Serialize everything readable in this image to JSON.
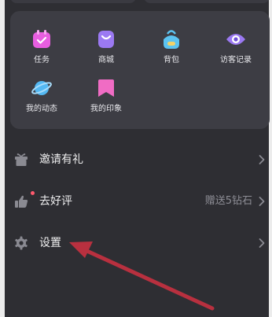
{
  "grid": {
    "items": [
      {
        "label": "任务",
        "icon": "task-calendar-icon",
        "color": "#e85ee0"
      },
      {
        "label": "商城",
        "icon": "shopping-bag-icon",
        "color": "#9b79f2"
      },
      {
        "label": "背包",
        "icon": "backpack-icon",
        "color": "#5cc4f2"
      },
      {
        "label": "访客记录",
        "icon": "eye-icon",
        "color": "#9b79f2"
      },
      {
        "label": "我的动态",
        "icon": "planet-icon",
        "color": "#54b8f2"
      },
      {
        "label": "我的印象",
        "icon": "bookmark-icon",
        "color": "#f06cc4"
      }
    ]
  },
  "menu": {
    "invite": {
      "label": "邀请有礼",
      "icon": "gift-icon"
    },
    "review": {
      "label": "去好评",
      "icon": "thumbs-up-icon",
      "note": "赠送5钻石"
    },
    "settings": {
      "label": "设置",
      "icon": "gear-icon"
    }
  },
  "annotation": {
    "arrow_color": "#b8303f"
  }
}
